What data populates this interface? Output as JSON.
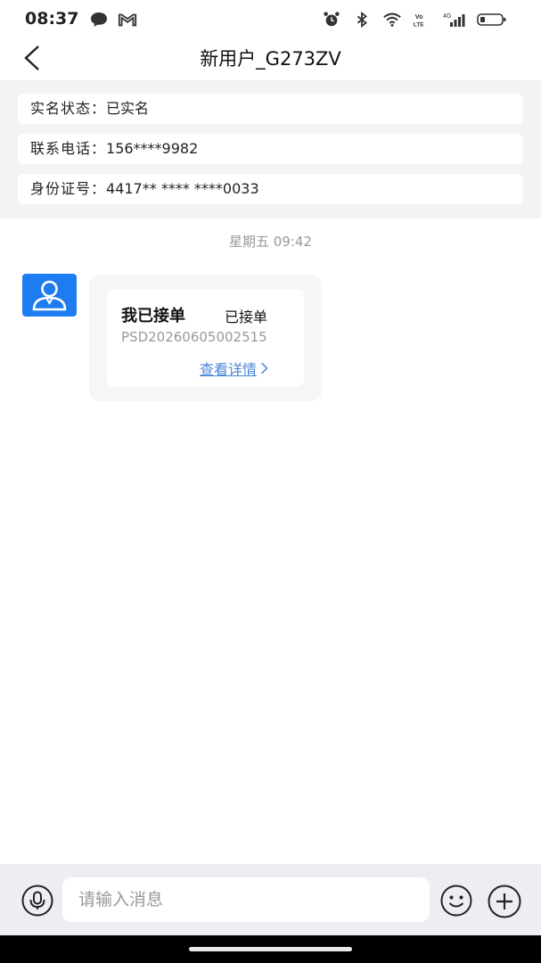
{
  "status_bar": {
    "time": "08:37",
    "left_icons": [
      "chat-bubble-icon",
      "gmail-icon"
    ],
    "right_icons": [
      "alarm-icon",
      "bluetooth-icon",
      "wifi-icon",
      "volte-icon",
      "signal-4g-icon",
      "battery-icon"
    ],
    "volte_text": "Vo LTE",
    "network_text": "4G"
  },
  "nav": {
    "title": "新用户_G273ZV",
    "back_icon": "chevron-left-icon"
  },
  "info": {
    "realname_label": "实名状态：",
    "realname_value": "已实名",
    "phone_label": "联系电话：",
    "phone_value": "156****9982",
    "id_label": "身份证号：",
    "id_value": "4417** **** ****0033"
  },
  "chat": {
    "timestamp": "星期五 09:42",
    "avatar_icon": "user-avatar-icon",
    "card": {
      "title": "我已接单",
      "status": "已接单",
      "order_no": "PSD20260605002515",
      "detail_link": "查看详情"
    }
  },
  "input": {
    "placeholder": "请输入消息",
    "voice_icon": "microphone-icon",
    "emoji_icon": "emoji-icon",
    "plus_icon": "plus-icon"
  },
  "colors": {
    "accent_blue": "#1e7cf0",
    "link_blue": "#4a86d8",
    "section_bg": "#f2f3f5",
    "input_bar_bg": "#eceef1"
  }
}
